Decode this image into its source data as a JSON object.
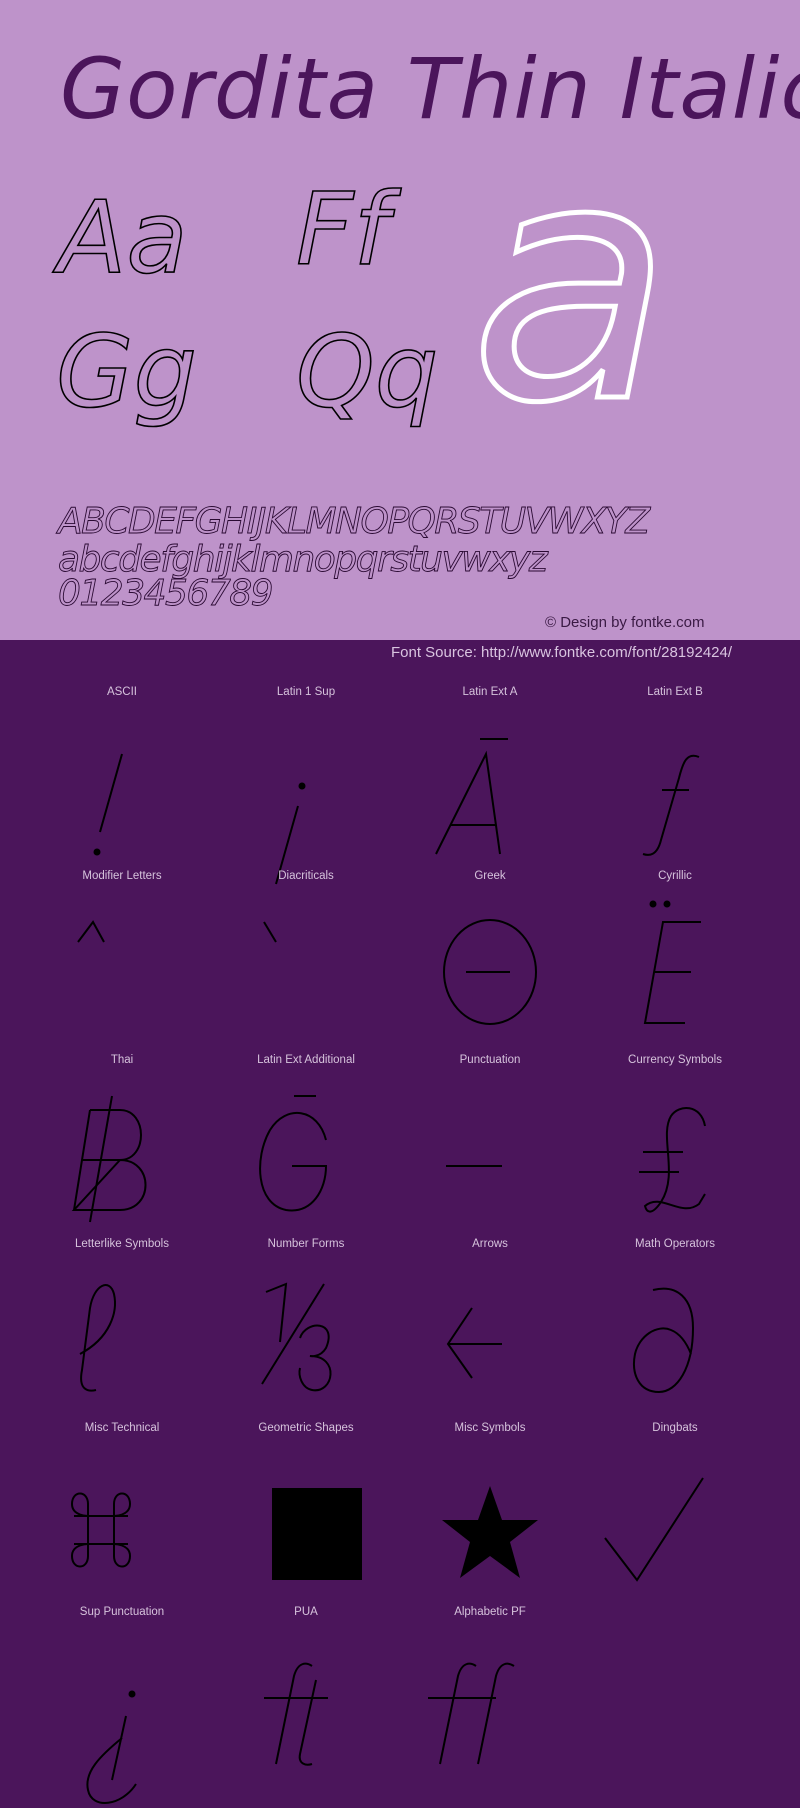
{
  "colors": {
    "preview_background": "#BE93CA",
    "grid_background": "#4B155B",
    "title_color": "#4B155B",
    "glyph_stroke": "#000000",
    "hero_glyph": "#FFFFFF",
    "label_color": "#D6C3DC"
  },
  "header": {
    "title": "Gordita Thin Italic"
  },
  "preview": {
    "pairs": [
      "Aa",
      "Ff",
      "Gg",
      "Qq"
    ],
    "hero_glyph": "a",
    "uppercase": "ABCDEFGHIJKLMNOPQRSTUVWXYZ",
    "lowercase": "abcdefghijklmnopqrstuvwxyz",
    "digits": "0123456789",
    "credit": "© Design by fontke.com"
  },
  "source": {
    "text": "Font Source: http://www.fontke.com/font/28192424/"
  },
  "blocks": [
    {
      "label": "ASCII",
      "glyph": "!",
      "icon": "exclamation-icon"
    },
    {
      "label": "Latin 1 Sup",
      "glyph": "¡",
      "icon": "inverted-exclamation-icon"
    },
    {
      "label": "Latin Ext A",
      "glyph": "Ā",
      "icon": "a-macron-icon"
    },
    {
      "label": "Latin Ext B",
      "glyph": "ƒ",
      "icon": "f-hook-icon"
    },
    {
      "label": "Modifier Letters",
      "glyph": "ˆ",
      "icon": "circumflex-icon"
    },
    {
      "label": "Diacriticals",
      "glyph": "̀",
      "icon": "grave-accent-icon"
    },
    {
      "label": "Greek",
      "glyph": "Θ",
      "icon": "theta-icon"
    },
    {
      "label": "Cyrillic",
      "glyph": "Ё",
      "icon": "cyrillic-io-icon"
    },
    {
      "label": "Thai",
      "glyph": "฿",
      "icon": "baht-icon"
    },
    {
      "label": "Latin Ext Additional",
      "glyph": "Ḡ",
      "icon": "g-macron-icon"
    },
    {
      "label": "Punctuation",
      "glyph": "–",
      "icon": "en-dash-icon"
    },
    {
      "label": "Currency Symbols",
      "glyph": "₤",
      "icon": "lira-icon"
    },
    {
      "label": "Letterlike Symbols",
      "glyph": "ℓ",
      "icon": "script-l-icon"
    },
    {
      "label": "Number Forms",
      "glyph": "⅓",
      "icon": "one-third-icon"
    },
    {
      "label": "Arrows",
      "glyph": "←",
      "icon": "left-arrow-icon"
    },
    {
      "label": "Math Operators",
      "glyph": "∂",
      "icon": "partial-differential-icon"
    },
    {
      "label": "Misc Technical",
      "glyph": "⌘",
      "icon": "command-icon"
    },
    {
      "label": "Geometric Shapes",
      "glyph": "■",
      "icon": "black-square-icon"
    },
    {
      "label": "Misc Symbols",
      "glyph": "★",
      "icon": "star-icon"
    },
    {
      "label": "Dingbats",
      "glyph": "✓",
      "icon": "check-mark-icon"
    },
    {
      "label": "Sup Punctuation",
      "glyph": "⸘",
      "icon": "inverted-interrobang-icon"
    },
    {
      "label": "PUA",
      "glyph": "ft",
      "icon": "ft-ligature-icon"
    },
    {
      "label": "Alphabetic PF",
      "glyph": "ﬀ",
      "icon": "ff-ligature-icon"
    }
  ]
}
